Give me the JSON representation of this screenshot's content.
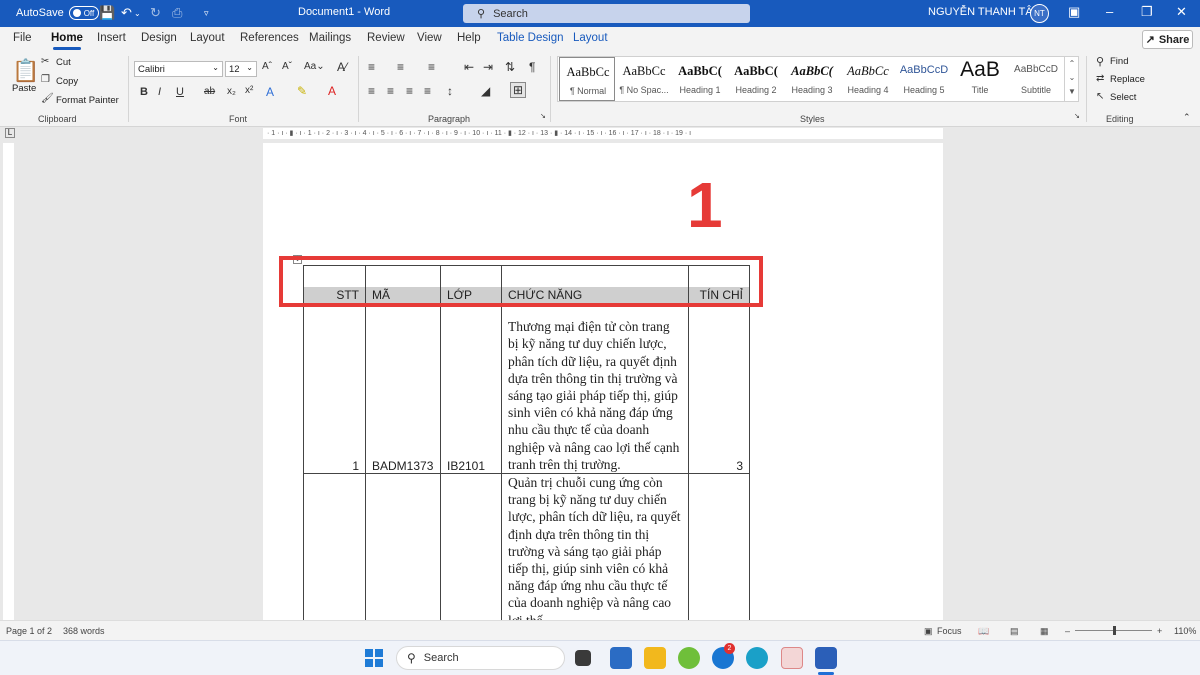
{
  "titlebar": {
    "autosave_label": "AutoSave",
    "autosave_state": "Off",
    "document_title": "Document1  -  Word",
    "search_placeholder": "Search",
    "user_name": "NGUYỄN THANH TÂM",
    "user_initials": "NT"
  },
  "tabs": [
    "File",
    "Home",
    "Insert",
    "Design",
    "Layout",
    "References",
    "Mailings",
    "Review",
    "View",
    "Help",
    "Table Design",
    "Layout"
  ],
  "share_label": "Share",
  "ribbon": {
    "clipboard": {
      "paste": "Paste",
      "cut": "Cut",
      "copy": "Copy",
      "format_painter": "Format Painter",
      "label": "Clipboard"
    },
    "font": {
      "family": "Calibri",
      "size": "12",
      "label": "Font"
    },
    "paragraph": {
      "label": "Paragraph"
    },
    "styles": {
      "label": "Styles",
      "items": [
        {
          "preview": "AaBbCc",
          "name": "¶ Normal"
        },
        {
          "preview": "AaBbCc",
          "name": "¶ No Spac..."
        },
        {
          "preview": "AaBbC(",
          "name": "Heading 1"
        },
        {
          "preview": "AaBbC(",
          "name": "Heading 2"
        },
        {
          "preview": "AaBbC(",
          "name": "Heading 3"
        },
        {
          "preview": "AaBbCc",
          "name": "Heading 4"
        },
        {
          "preview": "AaBbCcD",
          "name": "Heading 5"
        },
        {
          "preview": "AaB",
          "name": "Title"
        },
        {
          "preview": "AaBbCcD",
          "name": "Subtitle"
        }
      ]
    },
    "editing": {
      "find": "Find",
      "replace": "Replace",
      "select": "Select",
      "label": "Editing"
    }
  },
  "document": {
    "annotation_number": "1",
    "table": {
      "headers": [
        "STT",
        "MÃ",
        "LỚP",
        "CHỨC NĂNG",
        "TÍN CHỈ"
      ],
      "rows": [
        {
          "stt": "1",
          "ma": "BADM1373",
          "lop": "IB2101",
          "chuc_nang": "Thương mại điện tử còn trang bị kỹ năng tư duy chiến lược, phân tích dữ liệu, ra quyết định dựa trên thông tin thị trường và sáng tạo giải pháp tiếp thị, giúp sinh viên có khả năng đáp ứng nhu cầu thực tế của doanh nghiệp và nâng cao lợi thế cạnh tranh trên thị trường.",
          "tin_chi": "3"
        },
        {
          "stt": "",
          "ma": "",
          "lop": "",
          "chuc_nang": "Quản trị chuỗi cung ứng còn trang bị kỹ năng tư duy chiến lược, phân tích dữ liệu, ra quyết định dựa trên thông tin thị trường và sáng tạo giải pháp tiếp thị, giúp sinh viên có khả năng đáp ứng nhu cầu thực tế của doanh nghiệp và nâng cao lợi thế",
          "tin_chi": ""
        }
      ]
    }
  },
  "status": {
    "page": "Page 1 of 2",
    "words": "368 words",
    "focus": "Focus",
    "zoom": "110%"
  },
  "taskbar": {
    "search_placeholder": "Search",
    "badge_count": "2"
  }
}
